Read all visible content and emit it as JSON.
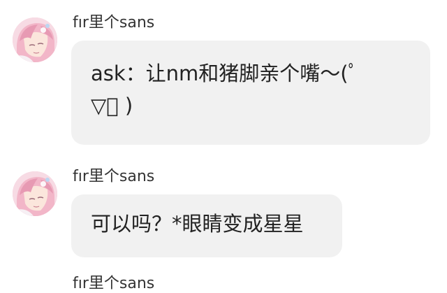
{
  "messages": [
    {
      "sender": "fır里个sans",
      "lines": [
        "ask：让nm和猪脚亲个嘴～(ﾟ",
        "▽ﾟ )"
      ]
    },
    {
      "sender": "fır里个sans",
      "lines": [
        "可以吗？*眼睛变成星星"
      ]
    },
    {
      "sender": "fır里个sans",
      "lines": []
    }
  ]
}
